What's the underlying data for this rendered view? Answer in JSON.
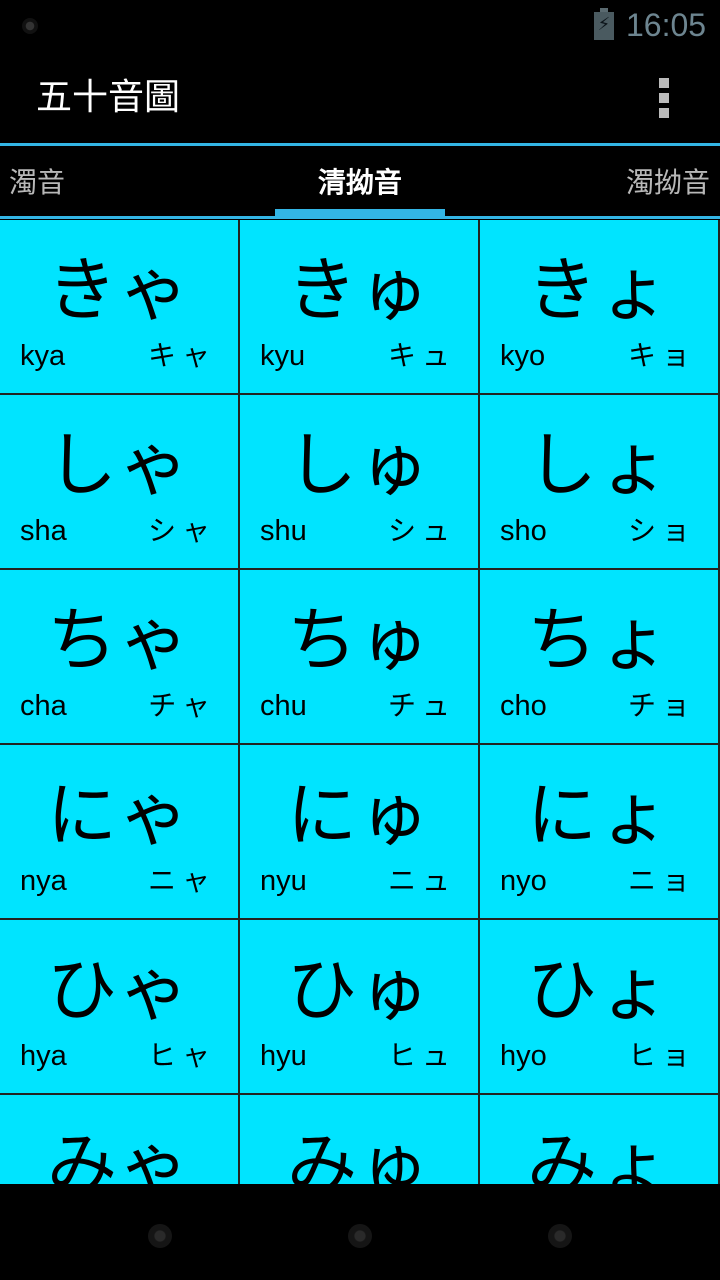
{
  "status_bar": {
    "time": "16:05",
    "icons": [
      "camera-dot-icon",
      "battery-charging-icon"
    ]
  },
  "action_bar": {
    "title": "五十音圖",
    "overflow_icon": "overflow-menu-icon"
  },
  "tabs": [
    {
      "label": "濁音",
      "selected": false
    },
    {
      "label": "清拗音",
      "selected": true
    },
    {
      "label": "濁拗音",
      "selected": false
    }
  ],
  "colors": {
    "accent": "#33b5e5",
    "cell_background": "#00e4ff",
    "status_text": "#6d8590"
  },
  "grid": {
    "rows": [
      [
        {
          "kana": "きゃ",
          "romaji": "kya",
          "katakana": "キャ"
        },
        {
          "kana": "きゅ",
          "romaji": "kyu",
          "katakana": "キュ"
        },
        {
          "kana": "きょ",
          "romaji": "kyo",
          "katakana": "キョ"
        }
      ],
      [
        {
          "kana": "しゃ",
          "romaji": "sha",
          "katakana": "シャ"
        },
        {
          "kana": "しゅ",
          "romaji": "shu",
          "katakana": "シュ"
        },
        {
          "kana": "しょ",
          "romaji": "sho",
          "katakana": "ショ"
        }
      ],
      [
        {
          "kana": "ちゃ",
          "romaji": "cha",
          "katakana": "チャ"
        },
        {
          "kana": "ちゅ",
          "romaji": "chu",
          "katakana": "チュ"
        },
        {
          "kana": "ちょ",
          "romaji": "cho",
          "katakana": "チョ"
        }
      ],
      [
        {
          "kana": "にゃ",
          "romaji": "nya",
          "katakana": "ニャ"
        },
        {
          "kana": "にゅ",
          "romaji": "nyu",
          "katakana": "ニュ"
        },
        {
          "kana": "にょ",
          "romaji": "nyo",
          "katakana": "ニョ"
        }
      ],
      [
        {
          "kana": "ひゃ",
          "romaji": "hya",
          "katakana": "ヒャ"
        },
        {
          "kana": "ひゅ",
          "romaji": "hyu",
          "katakana": "ヒュ"
        },
        {
          "kana": "ひょ",
          "romaji": "hyo",
          "katakana": "ヒョ"
        }
      ],
      [
        {
          "kana": "みゃ",
          "romaji": "",
          "katakana": ""
        },
        {
          "kana": "みゅ",
          "romaji": "",
          "katakana": ""
        },
        {
          "kana": "みょ",
          "romaji": "",
          "katakana": ""
        }
      ]
    ]
  },
  "nav_bar": {
    "buttons": [
      "back-button",
      "home-button",
      "recents-button"
    ]
  }
}
